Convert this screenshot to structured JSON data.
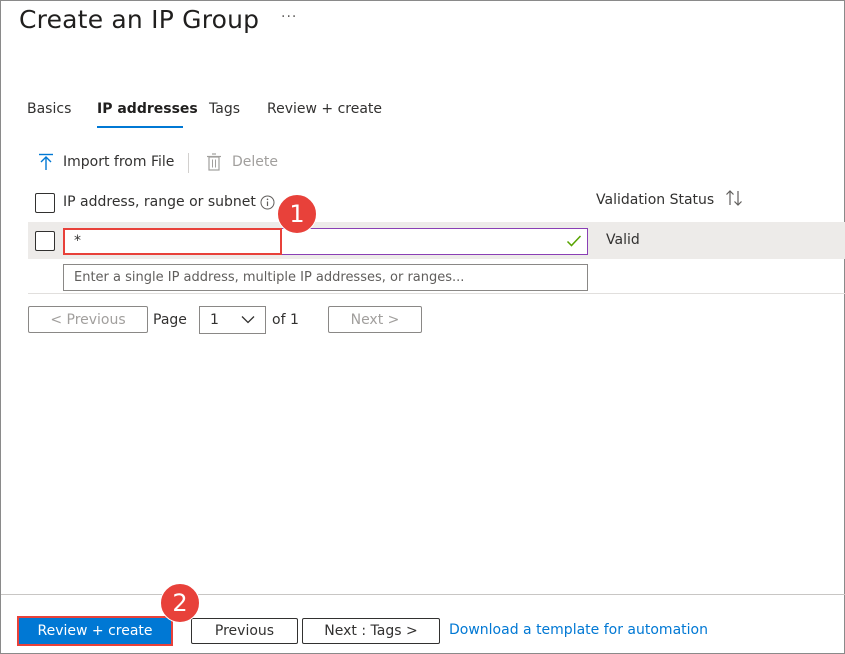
{
  "page": {
    "title": "Create an IP Group",
    "more_label": "···"
  },
  "tabs": [
    {
      "label": "Basics"
    },
    {
      "label": "IP addresses"
    },
    {
      "label": "Tags"
    },
    {
      "label": "Review + create"
    }
  ],
  "toolbar": {
    "import_label": "Import from File",
    "delete_label": "Delete"
  },
  "table": {
    "col_ip": "IP address, range or subnet",
    "col_status": "Validation Status",
    "rows": [
      {
        "value": "*",
        "status": "Valid"
      }
    ],
    "new_row_placeholder": "Enter a single IP address, multiple IP addresses, or ranges..."
  },
  "pagination": {
    "prev_label": "< Previous",
    "page_label": "Page",
    "page_value": "1",
    "of_label": "of 1",
    "next_label": "Next >"
  },
  "footer": {
    "review_create": "Review + create",
    "previous": "Previous",
    "next_tags": "Next : Tags >",
    "download_link": "Download a template for automation"
  },
  "annotations": {
    "step1": "1",
    "step2": "2"
  },
  "colors": {
    "accent": "#0078d4",
    "annotation": "#e8413a",
    "valid_check": "#57a300"
  }
}
